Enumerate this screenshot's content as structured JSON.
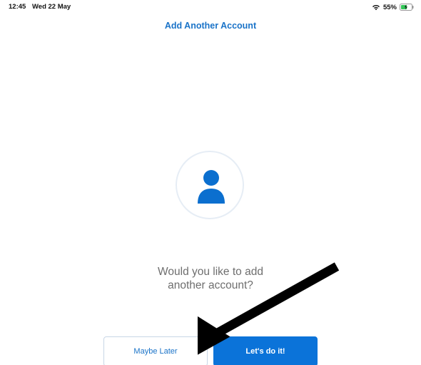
{
  "status_bar": {
    "time": "12:45",
    "date": "Wed 22 May",
    "battery_percent": "55%",
    "battery_level": 0.55,
    "wifi_icon": "wifi-icon",
    "battery_icon": "battery-charging-icon"
  },
  "header": {
    "title": "Add Another Account"
  },
  "avatar": {
    "icon": "person-icon"
  },
  "prompt": {
    "line1": "Would you like to add",
    "line2": "another account?"
  },
  "buttons": {
    "maybe_later": "Maybe Later",
    "lets_do_it": "Let's do it!"
  },
  "colors": {
    "accent": "#1a73c8",
    "primary_button": "#0b73d9",
    "battery_fill": "#34c759"
  },
  "annotation": {
    "arrow_icon": "annotation-arrow"
  }
}
